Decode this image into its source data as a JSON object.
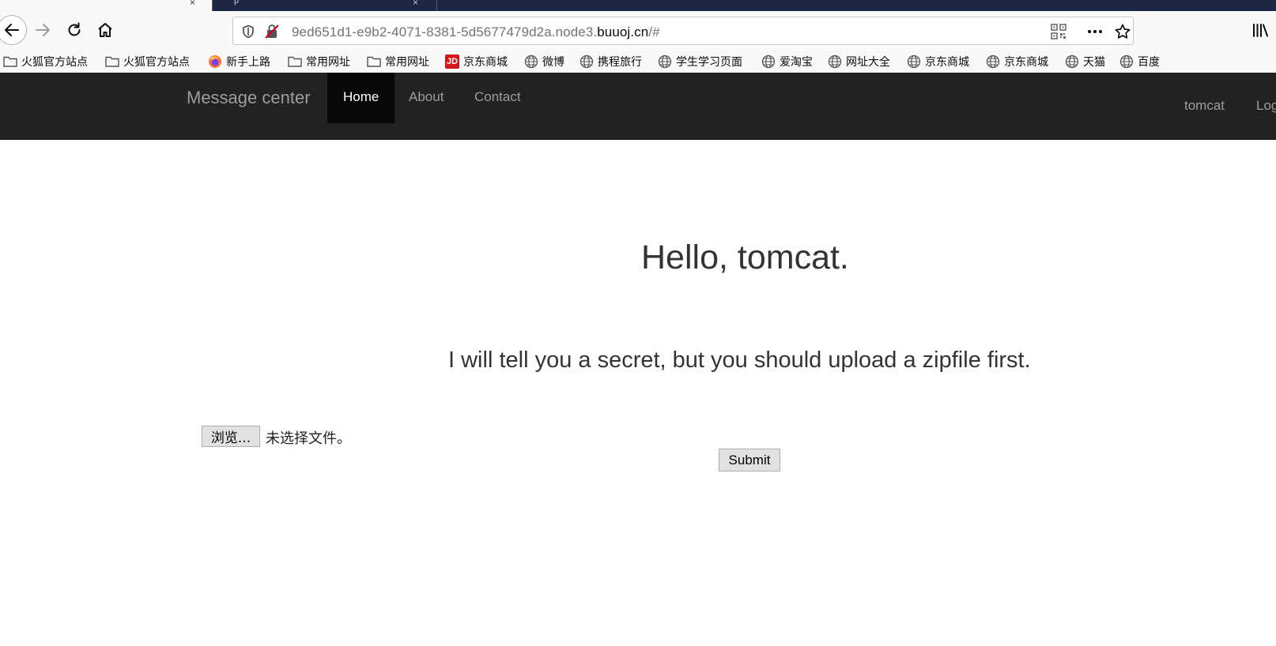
{
  "browser": {
    "tab_fragment": "p",
    "tab_close_glyph": "×",
    "url_path_prefix": "9ed651d1-e9b2-4071-8381-5d5677479d2a.node3.",
    "url_host": "buuoj.cn",
    "url_suffix": "/#",
    "bookmarks": [
      {
        "label": "火狐官方站点",
        "icon": "folder-icon"
      },
      {
        "label": "火狐官方站点",
        "icon": "folder-icon"
      },
      {
        "label": "新手上路",
        "icon": "firefox-icon"
      },
      {
        "label": "常用网址",
        "icon": "folder-icon"
      },
      {
        "label": "常用网址",
        "icon": "folder-icon"
      },
      {
        "label": "京东商城",
        "icon": "jd-icon",
        "icon_text": "JD"
      },
      {
        "label": "微博",
        "icon": "globe-icon"
      },
      {
        "label": "携程旅行",
        "icon": "globe-icon"
      },
      {
        "label": "学生学习页面",
        "icon": "globe-icon"
      },
      {
        "label": "爱淘宝",
        "icon": "globe-icon"
      },
      {
        "label": "网址大全",
        "icon": "globe-icon"
      },
      {
        "label": "京东商城",
        "icon": "globe-icon"
      },
      {
        "label": "京东商城",
        "icon": "globe-icon"
      },
      {
        "label": "天猫",
        "icon": "globe-icon"
      },
      {
        "label": "百度",
        "icon": "globe-icon"
      }
    ],
    "colors": {
      "tabstrip": "#1c2541",
      "chrome": "#f9f9fa",
      "jd_red": "#d7141a"
    }
  },
  "site": {
    "brand": "Message center",
    "nav": {
      "home": "Home",
      "about": "About",
      "contact": "Contact",
      "user": "tomcat",
      "logout": "Log"
    },
    "colors": {
      "navbar_bg": "#222222",
      "navbar_active": "#080808",
      "nav_link": "#9d9d9d"
    }
  },
  "main": {
    "greeting": "Hello, tomcat.",
    "message": "I will tell you a secret, but you should upload a zipfile first.",
    "browse_label": "浏览...",
    "no_file_text": "未选择文件。",
    "submit_label": "Submit"
  }
}
